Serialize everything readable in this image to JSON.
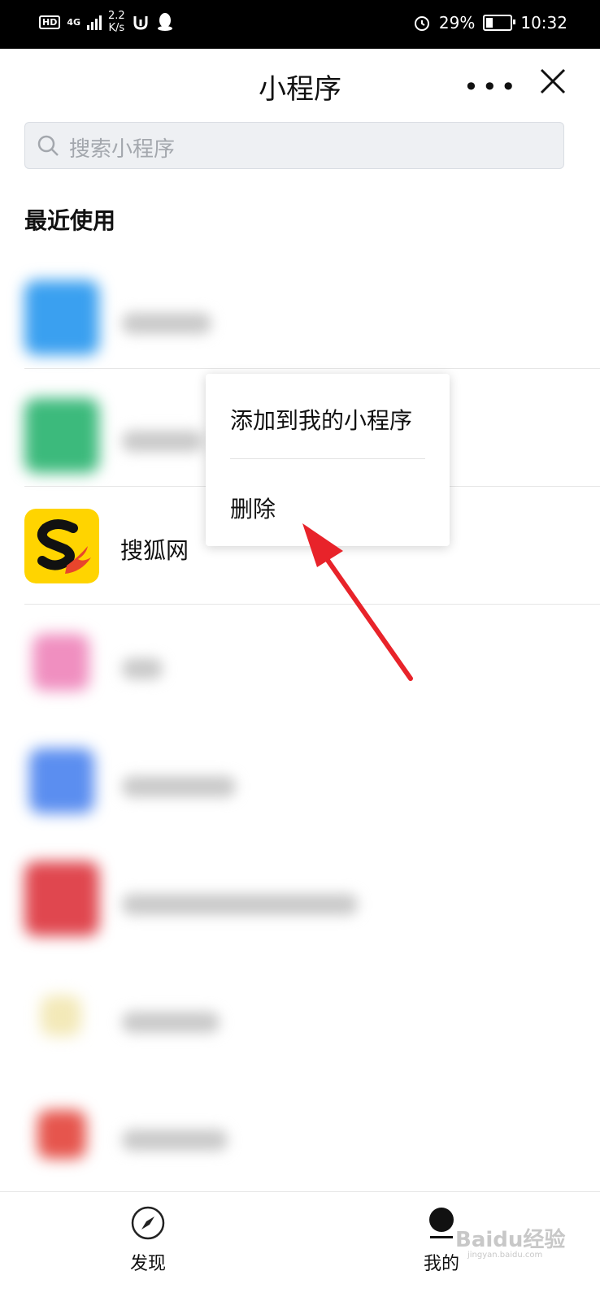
{
  "status_bar": {
    "hd": "HD",
    "network": "4G",
    "speed_value": "2.2",
    "speed_unit": "K/s",
    "battery": "29%",
    "battery_level": 0.29,
    "time": "10:32"
  },
  "header": {
    "title": "小程序",
    "more_icon": "more-icon",
    "close_icon": "close-icon"
  },
  "search": {
    "placeholder": "搜索小程序",
    "icon": "search-icon"
  },
  "section": {
    "title": "最近使用"
  },
  "list": {
    "items": [
      {
        "label": "",
        "blurred": true,
        "color": "#3aa0f0"
      },
      {
        "label": "",
        "blurred": true,
        "color": "#3cba7c"
      },
      {
        "label": "搜狐网",
        "blurred": false,
        "color": "#ffd400"
      },
      {
        "label": "",
        "blurred": true,
        "color": "#f08fc0"
      },
      {
        "label": "",
        "blurred": true,
        "color": "#5b8ef0"
      },
      {
        "label": "",
        "blurred": true,
        "color": "#e0474f"
      },
      {
        "label": "",
        "blurred": true,
        "color": "#f3e9b8"
      },
      {
        "label": "",
        "blurred": true,
        "color": "#e6554d"
      }
    ]
  },
  "context_menu": {
    "add_label": "添加到我的小程序",
    "delete_label": "删除"
  },
  "tabbar": {
    "discover_label": "发现",
    "mine_label": "我的"
  },
  "watermark": {
    "text": "Baidu经验",
    "sub": "jingyan.baidu.com"
  },
  "colors": {
    "annotation_arrow": "#e8232a",
    "status_bar_bg": "#000000"
  }
}
